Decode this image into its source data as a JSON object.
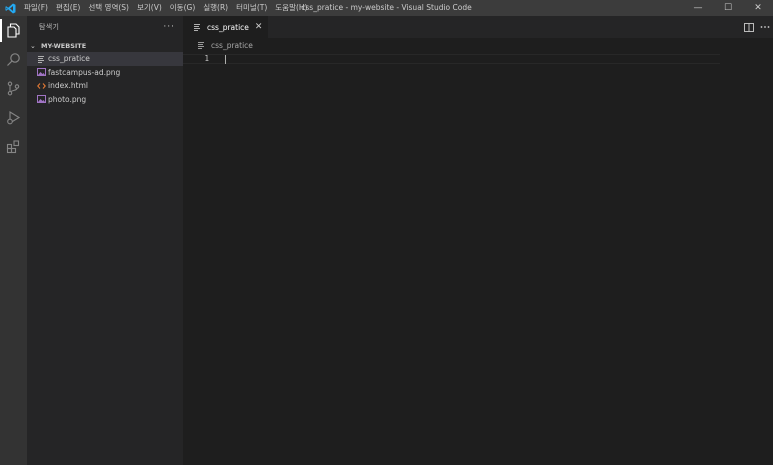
{
  "titlebar": {
    "menu": [
      "파일(F)",
      "편집(E)",
      "선택 영역(S)",
      "보기(V)",
      "이동(G)",
      "실행(R)",
      "터미널(T)",
      "도움말(H)"
    ],
    "window_title": "css_pratice - my-website - Visual Studio Code",
    "controls": {
      "minimize": "—",
      "maximize": "☐",
      "close": "✕"
    }
  },
  "activitybar": {
    "items": [
      "explorer-icon",
      "search-icon",
      "source-control-icon",
      "run-debug-icon",
      "extensions-icon"
    ]
  },
  "sidebar": {
    "title": "탐색기",
    "more": "···",
    "folder": {
      "chevron": "⌄",
      "name": "MY-WEBSITE"
    },
    "files": [
      {
        "label": "css_pratice",
        "icon": "text-lines-icon",
        "selected": true
      },
      {
        "label": "fastcampus-ad.png",
        "icon": "image-file-icon",
        "selected": false
      },
      {
        "label": "index.html",
        "icon": "html-file-icon",
        "selected": false
      },
      {
        "label": "photo.png",
        "icon": "image-file-icon",
        "selected": false
      }
    ]
  },
  "editor": {
    "tab": {
      "label": "css_pratice",
      "close": "✕"
    },
    "breadcrumb": "css_pratice",
    "line_numbers": [
      "1"
    ]
  },
  "colors": {
    "accent_blue": "#007acc",
    "image_icon": "#a074c4",
    "html_icon": "#e37933",
    "titlebar_bg": "#3c3c3c",
    "activitybar_bg": "#333333",
    "sidebar_bg": "#252526",
    "editor_bg": "#1e1e1e"
  }
}
